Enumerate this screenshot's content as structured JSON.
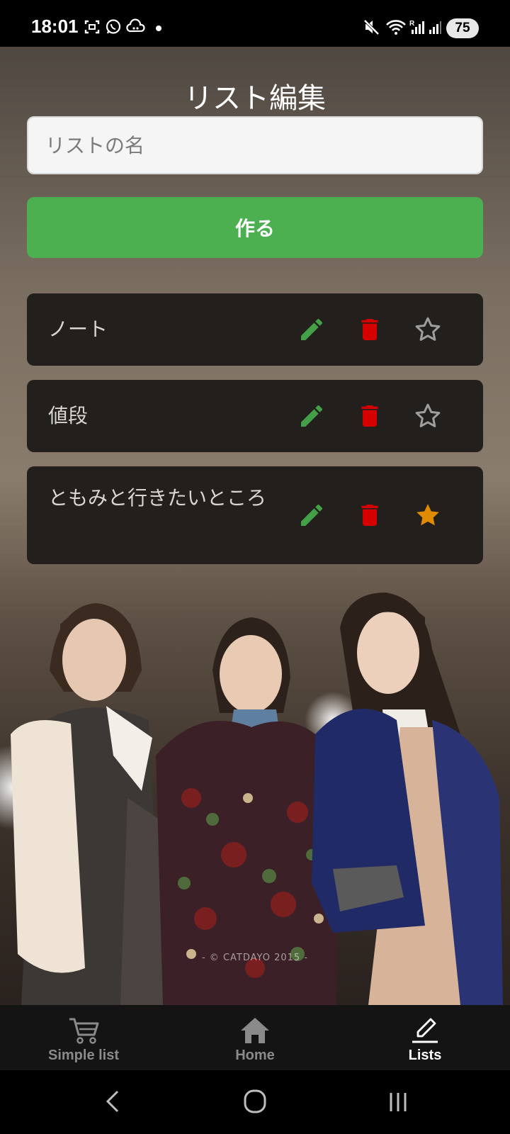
{
  "status_bar": {
    "time": "18:01",
    "battery": "75",
    "left_icons": [
      "screenshot-icon",
      "whatsapp-icon",
      "cloud-icon",
      "dot-icon"
    ],
    "right_icons": [
      "mute-icon",
      "wifi-icon",
      "signal-icon",
      "signal-icon"
    ]
  },
  "page": {
    "title": "リスト編集",
    "input_placeholder": "リストの名",
    "input_value": "",
    "create_label": "作る"
  },
  "lists": [
    {
      "name": "ノート",
      "starred": false
    },
    {
      "name": "値段",
      "starred": false
    },
    {
      "name": "ともみと行きたいところ",
      "starred": true
    }
  ],
  "photo": {
    "watermark": "- © CATDAYO 2015 -"
  },
  "bottom_nav": {
    "items": [
      {
        "label": "Simple list",
        "icon": "cart-icon",
        "active": false
      },
      {
        "label": "Home",
        "icon": "home-icon",
        "active": false
      },
      {
        "label": "Lists",
        "icon": "edit-icon",
        "active": true
      }
    ]
  },
  "colors": {
    "primary_green": "#4caf50",
    "edit_icon": "#43a047",
    "delete_icon": "#d50000",
    "star_filled": "#e08a00",
    "star_outline": "#9e9e9e",
    "card_background": "#231f1c"
  },
  "system_nav": [
    "back-icon",
    "home-circle-icon",
    "recents-icon"
  ]
}
